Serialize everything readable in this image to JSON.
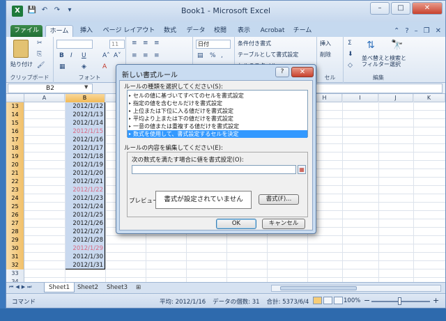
{
  "window": {
    "title": "Book1 - Microsoft Excel",
    "app_icon": "X",
    "controls": {
      "minimize": "–",
      "maximize": "□",
      "close": "✕"
    }
  },
  "quick_access": {
    "save_icon": "💾",
    "undo_icon": "↶",
    "redo_icon": "↷",
    "more_icon": "▾"
  },
  "tabs": [
    {
      "label": "ファイル"
    },
    {
      "label": "ホーム"
    },
    {
      "label": "挿入"
    },
    {
      "label": "ページ レイアウト"
    },
    {
      "label": "数式"
    },
    {
      "label": "データ"
    },
    {
      "label": "校閲"
    },
    {
      "label": "表示"
    },
    {
      "label": "Acrobat"
    },
    {
      "label": "チーム"
    }
  ],
  "active_tab": "ホーム",
  "ribbon": {
    "paste_label": "貼り付け",
    "clipboard_label": "クリップボード",
    "font_label": "フォント",
    "font_size": "11",
    "number_format": "日付",
    "cond_format": "条件付き書式",
    "table_format": "テーブルとして書式設定",
    "cell_style": "セルのスタイル",
    "insert": "挿入",
    "delete": "削除",
    "sort_filter": "並べ替えと\nフィルター",
    "find_select": "検索と\n選択",
    "editing_label": "編集",
    "cells_partial": "セル"
  },
  "formula_bar": {
    "name_box": "B2",
    "fx": ""
  },
  "columns": [
    "A",
    "B",
    "C",
    "D",
    "E",
    "F",
    "G",
    "H",
    "I",
    "J",
    "K"
  ],
  "selected_column": "B",
  "rows": [
    {
      "num": "13",
      "b": "2012/1/12",
      "weekend": false
    },
    {
      "num": "14",
      "b": "2012/1/13",
      "weekend": false
    },
    {
      "num": "15",
      "b": "2012/1/14",
      "weekend": false
    },
    {
      "num": "16",
      "b": "2012/1/15",
      "weekend": true
    },
    {
      "num": "17",
      "b": "2012/1/16",
      "weekend": false
    },
    {
      "num": "18",
      "b": "2012/1/17",
      "weekend": false
    },
    {
      "num": "19",
      "b": "2012/1/18",
      "weekend": false
    },
    {
      "num": "20",
      "b": "2012/1/19",
      "weekend": false
    },
    {
      "num": "21",
      "b": "2012/1/20",
      "weekend": false
    },
    {
      "num": "22",
      "b": "2012/1/21",
      "weekend": false
    },
    {
      "num": "23",
      "b": "2012/1/22",
      "weekend": true
    },
    {
      "num": "24",
      "b": "2012/1/23",
      "weekend": false
    },
    {
      "num": "25",
      "b": "2012/1/24",
      "weekend": false
    },
    {
      "num": "26",
      "b": "2012/1/25",
      "weekend": false
    },
    {
      "num": "27",
      "b": "2012/1/26",
      "weekend": false
    },
    {
      "num": "28",
      "b": "2012/1/27",
      "weekend": false
    },
    {
      "num": "29",
      "b": "2012/1/28",
      "weekend": false
    },
    {
      "num": "30",
      "b": "2012/1/29",
      "weekend": true
    },
    {
      "num": "31",
      "b": "2012/1/30",
      "weekend": false
    },
    {
      "num": "32",
      "b": "2012/1/31",
      "weekend": false
    },
    {
      "num": "33",
      "b": "",
      "weekend": false
    },
    {
      "num": "34",
      "b": "",
      "weekend": false
    }
  ],
  "sheets": [
    "Sheet1",
    "Sheet2",
    "Sheet3"
  ],
  "active_sheet": "Sheet1",
  "statusbar": {
    "mode": "コマンド",
    "average": "平均: 2012/1/16",
    "count": "データの個数: 31",
    "sum": "合計: 5373/6/4",
    "zoom": "100%"
  },
  "dialog": {
    "title": "新しい書式ルール",
    "help": "?",
    "close": "✕",
    "rule_type_label": "ルールの種類を選択してください(S):",
    "rule_types": [
      "セルの値に基づいてすべてのセルを書式設定",
      "指定の値を含むセルだけを書式設定",
      "上位または下位に入る値だけを書式設定",
      "平均より上または下の値だけを書式設定",
      "一意の値または重複する値だけを書式設定",
      "数式を使用して、書式設定するセルを決定"
    ],
    "selected_rule_index": 5,
    "edit_label": "ルールの内容を編集してください(E):",
    "formula_label": "次の数式を満たす場合に値を書式設定(O):",
    "formula_value": "",
    "preview_label": "プレビュー:",
    "preview_text": "書式が設定されていません",
    "format_button": "書式(F)...",
    "ok_button": "OK",
    "cancel_button": "キャンセル"
  }
}
